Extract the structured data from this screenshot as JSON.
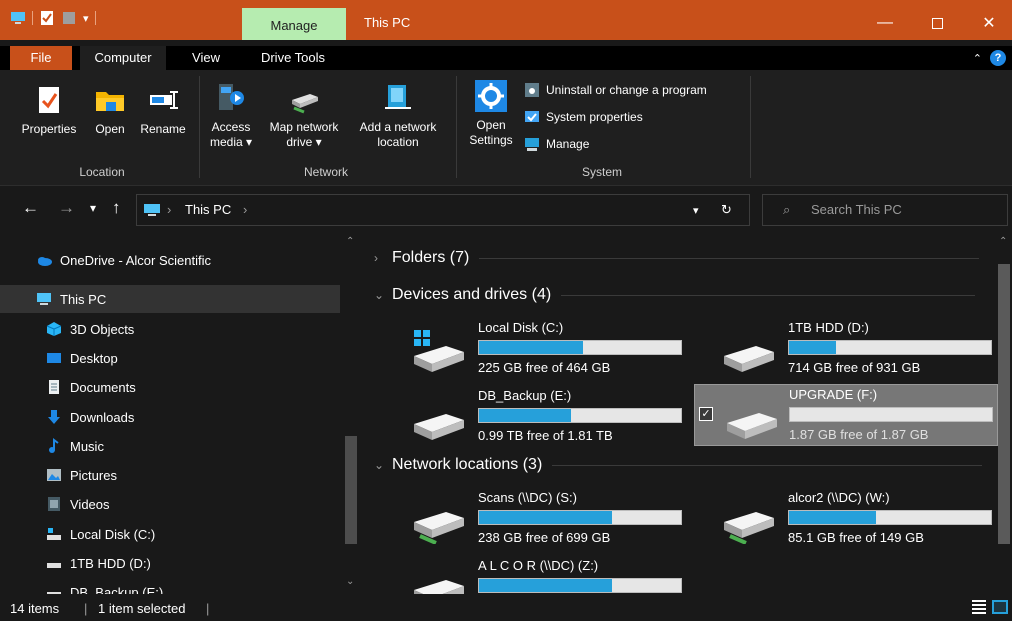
{
  "titlebar": {
    "title": "This PC",
    "contextual_tab": "Manage",
    "accent": "#c8501a",
    "controls": [
      "minimize-icon",
      "maximize-icon",
      "close-icon"
    ]
  },
  "menu": {
    "tabs": [
      "File",
      "Computer",
      "View",
      "Drive Tools"
    ],
    "active": "Computer"
  },
  "ribbon": {
    "location": {
      "label": "Location",
      "buttons": [
        {
          "label": "Properties",
          "icon": "properties-icon"
        },
        {
          "label": "Open",
          "icon": "open-folder-icon"
        },
        {
          "label": "Rename",
          "icon": "rename-icon"
        }
      ]
    },
    "network": {
      "label": "Network",
      "buttons": [
        {
          "label1": "Access",
          "label2": "media ▾",
          "icon": "access-media-icon"
        },
        {
          "label1": "Map network",
          "label2": "drive ▾",
          "icon": "map-drive-icon"
        },
        {
          "label1": "Add a network",
          "label2": "location",
          "icon": "add-network-location-icon"
        }
      ]
    },
    "system": {
      "label": "System",
      "open_settings1": "Open",
      "open_settings2": "Settings",
      "items": [
        "Uninstall or change a program",
        "System properties",
        "Manage"
      ]
    }
  },
  "address": {
    "crumb": "This PC",
    "search_placeholder": "Search This PC"
  },
  "nav": {
    "items": [
      {
        "label": "OneDrive - Alcor Scientific",
        "icon": "onedrive-icon"
      },
      {
        "label": "This PC",
        "icon": "this-pc-icon",
        "selected": true
      },
      {
        "label": "3D Objects",
        "icon": "3d-objects-icon"
      },
      {
        "label": "Desktop",
        "icon": "desktop-icon"
      },
      {
        "label": "Documents",
        "icon": "documents-icon"
      },
      {
        "label": "Downloads",
        "icon": "downloads-icon"
      },
      {
        "label": "Music",
        "icon": "music-icon"
      },
      {
        "label": "Pictures",
        "icon": "pictures-icon"
      },
      {
        "label": "Videos",
        "icon": "videos-icon"
      },
      {
        "label": "Local Disk (C:)",
        "icon": "local-disk-icon"
      },
      {
        "label": "1TB HDD (D:)",
        "icon": "hdd-icon"
      },
      {
        "label": "DB_Backup (E:)",
        "icon": "hdd-icon"
      }
    ]
  },
  "groups": {
    "folders": "Folders (7)",
    "devices": "Devices and drives (4)",
    "network": "Network locations (3)"
  },
  "drives": [
    {
      "name": "Local Disk (C:)",
      "free": "225 GB free of 464 GB",
      "used_fraction": 0.515,
      "icon": "windows-drive-icon",
      "selected": false
    },
    {
      "name": "1TB HDD (D:)",
      "free": "714 GB free of 931 GB",
      "used_fraction": 0.233,
      "icon": "hdd-icon",
      "selected": false
    },
    {
      "name": "DB_Backup (E:)",
      "free": "0.99 TB free of 1.81 TB",
      "used_fraction": 0.453,
      "icon": "hdd-icon",
      "selected": false
    },
    {
      "name": "UPGRADE (F:)",
      "free": "1.87 GB free of 1.87 GB",
      "used_fraction": 0.0,
      "icon": "hdd-icon",
      "selected": true
    }
  ],
  "network_drives": [
    {
      "name": "Scans (\\\\DC) (S:)",
      "free": "238 GB free of 699 GB",
      "used_fraction": 0.66,
      "icon": "network-drive-icon"
    },
    {
      "name": "alcor2 (\\\\DC) (W:)",
      "free": "85.1 GB free of 149 GB",
      "used_fraction": 0.43,
      "icon": "network-drive-icon"
    },
    {
      "name": "A L C O R (\\\\DC) (Z:)",
      "free": "",
      "used_fraction": 0.66,
      "icon": "network-drive-icon"
    }
  ],
  "status": {
    "count": "14 items",
    "selected": "1 item selected"
  }
}
